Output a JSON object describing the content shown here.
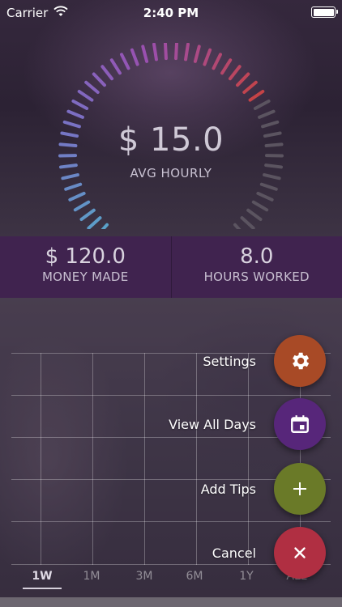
{
  "status_bar": {
    "carrier": "Carrier",
    "time": "2:40 PM"
  },
  "gauge": {
    "value": "$ 15.0",
    "label": "AVG HOURLY",
    "colors": [
      "#5aa0c8",
      "#7b6fc4",
      "#9a4fb0",
      "#c8423f",
      "#5b5460"
    ]
  },
  "stats": {
    "money_made": {
      "value": "$ 120.0",
      "label": "MONEY MADE"
    },
    "hours_worked": {
      "value": "8.0",
      "label": "HOURS WORKED"
    }
  },
  "range_tabs": [
    {
      "label": "1W",
      "active": true
    },
    {
      "label": "1M",
      "active": false
    },
    {
      "label": "3M",
      "active": false
    },
    {
      "label": "6M",
      "active": false
    },
    {
      "label": "1Y",
      "active": false
    },
    {
      "label": "ALL",
      "active": false
    }
  ],
  "fab_menu": {
    "settings": {
      "label": "Settings",
      "icon": "gear-icon",
      "color": "#a84a26"
    },
    "view_all_days": {
      "label": "View All Days",
      "icon": "calendar-icon",
      "color": "#57267a"
    },
    "add_tips": {
      "label": "Add Tips",
      "icon": "plus-icon",
      "color": "#6a7a28"
    },
    "cancel": {
      "label": "Cancel",
      "icon": "close-icon",
      "color": "#b02f42"
    }
  }
}
